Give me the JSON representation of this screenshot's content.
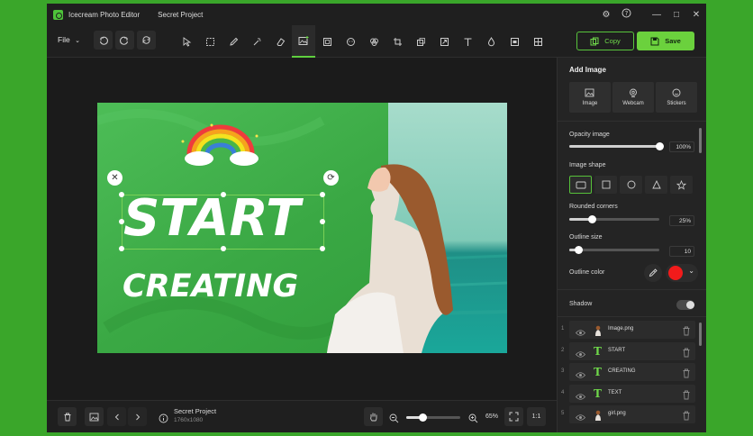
{
  "app": {
    "name": "Icecream Photo Editor",
    "project": "Secret Project"
  },
  "window_controls": {
    "settings": "⚙",
    "help": "?",
    "minimize": "—",
    "maximize": "□",
    "close": "✕"
  },
  "toolbar": {
    "file_label": "File",
    "copy_label": "Copy",
    "save_label": "Save"
  },
  "canvas": {
    "text_start": "START",
    "text_creating": "CREATING"
  },
  "bottom": {
    "project_name": "Secret Project",
    "project_size": "1760x1080",
    "zoom_value": "65%",
    "zoom_fraction": 0.3,
    "fit_label": "1:1"
  },
  "panel": {
    "title": "Add Image",
    "tabs": [
      {
        "label": "Image"
      },
      {
        "label": "Webcam"
      },
      {
        "label": "Stickers"
      }
    ],
    "opacity_label": "Opacity image",
    "opacity_value": "100%",
    "opacity_fraction": 1.0,
    "shape_label": "Image shape",
    "rounded_label": "Rounded corners",
    "rounded_value": "25%",
    "rounded_fraction": 0.25,
    "outline_size_label": "Outline size",
    "outline_size_value": "10",
    "outline_size_fraction": 0.1,
    "outline_color_label": "Outline color",
    "outline_color": "#f21b1b",
    "shadow_label": "Shadow"
  },
  "layers": [
    {
      "num": "1",
      "name": "Image.png",
      "kind": "image"
    },
    {
      "num": "2",
      "name": "START",
      "kind": "text"
    },
    {
      "num": "3",
      "name": "CREATING",
      "kind": "text"
    },
    {
      "num": "4",
      "name": "TEXT",
      "kind": "text"
    },
    {
      "num": "5",
      "name": "girl.png",
      "kind": "image"
    }
  ],
  "colors": {
    "accent": "#6bd13d",
    "background": "#3aa62a",
    "window": "#232323"
  }
}
